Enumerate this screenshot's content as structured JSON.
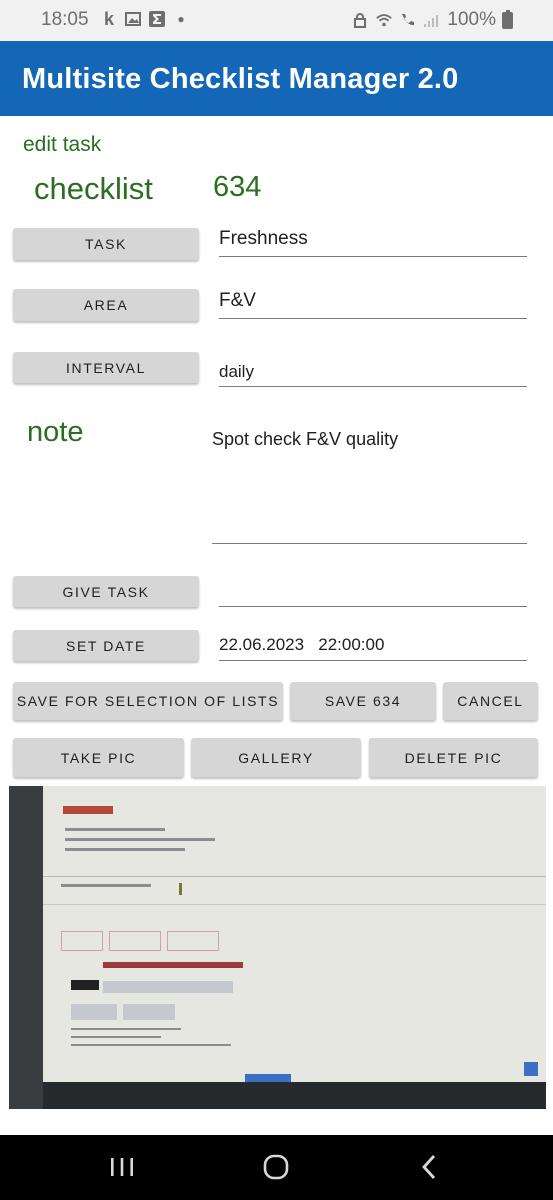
{
  "status_bar": {
    "time": "18:05",
    "battery": "100%"
  },
  "app": {
    "title": "Multisite Checklist Manager 2.0"
  },
  "form": {
    "heading": "edit task",
    "checklist_label": "checklist",
    "checklist_id": "634",
    "task_button": "TASK",
    "task_value": "Freshness",
    "area_button": "AREA",
    "area_value": "F&V",
    "interval_button": "INTERVAL",
    "interval_value": "daily",
    "note_label": "note",
    "note_value": "Spot check F&V quality",
    "give_task_button": "GIVE TASK",
    "give_task_value": "",
    "set_date_button": "SET DATE",
    "date_value": "22.06.2023   22:00:00"
  },
  "actions": {
    "save_selection": "SAVE FOR SELECTION OF LISTS",
    "save_id": "SAVE 634",
    "cancel": "CANCEL",
    "take_pic": "TAKE PIC",
    "gallery": "GALLERY",
    "delete_pic": "DELETE PIC"
  },
  "icons": {
    "nav_recent": "recent-apps-icon",
    "nav_home": "home-icon",
    "nav_back": "back-icon"
  },
  "colors": {
    "app_bar": "#1466b7",
    "label_green": "#2a6e22",
    "button_gray": "#d6d6d6"
  }
}
